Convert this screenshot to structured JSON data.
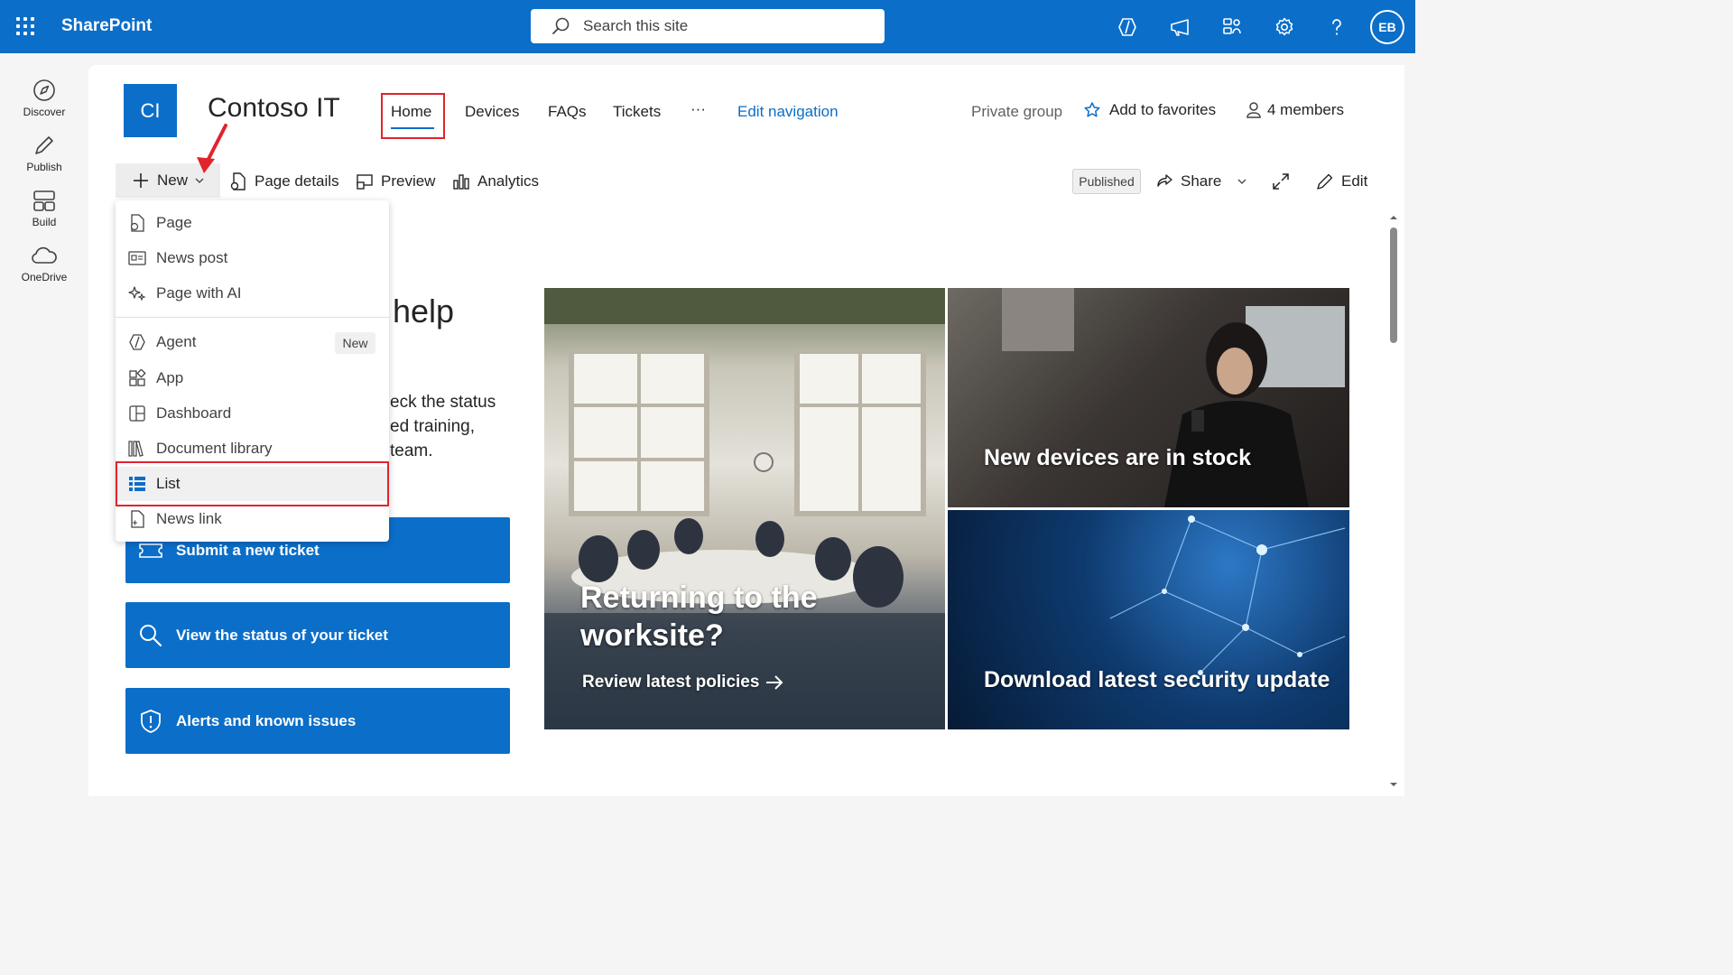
{
  "suite": {
    "brand": "SharePoint",
    "search_placeholder": "Search this site",
    "avatar_initials": "EB",
    "accent": "#0b6ec9"
  },
  "appbar": {
    "items": [
      {
        "label": "Discover",
        "icon": "compass-icon"
      },
      {
        "label": "Publish",
        "icon": "pen-icon"
      },
      {
        "label": "Build",
        "icon": "grid-icon"
      },
      {
        "label": "OneDrive",
        "icon": "cloud-icon"
      }
    ]
  },
  "site": {
    "logo": "CI",
    "title": "Contoso IT",
    "nav": [
      "Home",
      "Devices",
      "FAQs",
      "Tickets",
      "···",
      "Edit navigation"
    ],
    "private_label": "Private group",
    "favorites_label": "Add to favorites",
    "members_label": "4 members"
  },
  "commandbar": {
    "new_label": "New",
    "page_details": "Page details",
    "preview": "Preview",
    "analytics": "Analytics",
    "status": "Published",
    "share": "Share",
    "edit": "Edit"
  },
  "menu": {
    "items": [
      {
        "label": "Page",
        "icon": "page-icon"
      },
      {
        "label": "News post",
        "icon": "news-icon"
      },
      {
        "label": "Page with AI",
        "icon": "sparkle-icon"
      },
      {
        "label": "Agent",
        "icon": "agent-icon",
        "badge": "New"
      },
      {
        "label": "App",
        "icon": "app-icon"
      },
      {
        "label": "Dashboard",
        "icon": "dashboard-icon"
      },
      {
        "label": "Document library",
        "icon": "library-icon"
      },
      {
        "label": "List",
        "icon": "list-icon",
        "selected": true
      },
      {
        "label": "News link",
        "icon": "newslink-icon"
      }
    ]
  },
  "body": {
    "heading_fragment": "help",
    "para_lines": [
      "eck the status",
      "ed training,",
      "team."
    ]
  },
  "quicklinks": [
    {
      "label": "Submit a new ticket",
      "icon": "ticket-icon"
    },
    {
      "label": "View the status of your ticket",
      "icon": "search-icon"
    },
    {
      "label": "Alerts and known issues",
      "icon": "shield-icon"
    }
  ],
  "hero": {
    "main_title": "Returning to the worksite?",
    "main_link": "Review latest policies",
    "tile2": "New devices are in stock",
    "tile3": "Download latest security update"
  }
}
